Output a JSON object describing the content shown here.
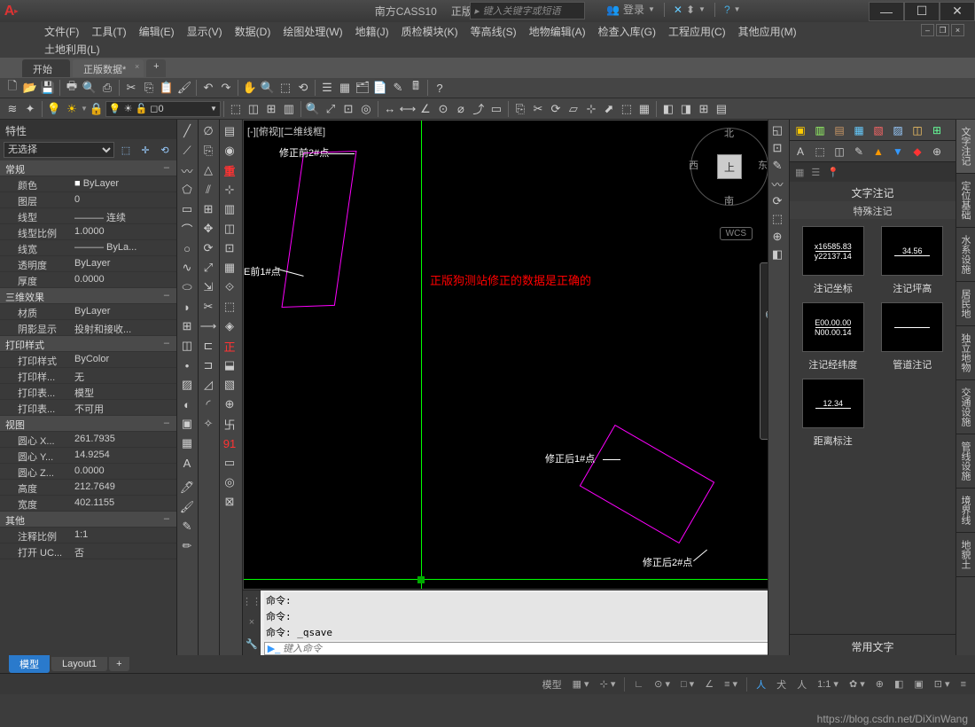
{
  "title": {
    "app": "南方CASS10",
    "file": "正版数据.dwg"
  },
  "top_search_placeholder": "键入关键字或短语",
  "login_label": "登录",
  "menus": [
    "文件(F)",
    "工具(T)",
    "编辑(E)",
    "显示(V)",
    "数据(D)",
    "绘图处理(W)",
    "地籍(J)",
    "质检模块(K)",
    "等高线(S)",
    "地物编辑(A)",
    "检查入库(G)",
    "工程应用(C)",
    "其他应用(M)"
  ],
  "menus2": [
    "土地利用(L)"
  ],
  "file_tabs": {
    "items": [
      "开始",
      "正版数据*"
    ],
    "active": 1
  },
  "layer_current": "0",
  "properties": {
    "title": "特性",
    "selection": "无选择",
    "sections": [
      {
        "name": "常规",
        "rows": [
          {
            "k": "颜色",
            "v": "ByLayer",
            "sq": true
          },
          {
            "k": "图层",
            "v": "0"
          },
          {
            "k": "线型",
            "v": "——— 连续"
          },
          {
            "k": "线型比例",
            "v": "1.0000"
          },
          {
            "k": "线宽",
            "v": "——— ByLa..."
          },
          {
            "k": "透明度",
            "v": "ByLayer"
          },
          {
            "k": "厚度",
            "v": "0.0000"
          }
        ]
      },
      {
        "name": "三维效果",
        "rows": [
          {
            "k": "材质",
            "v": "ByLayer"
          },
          {
            "k": "阴影显示",
            "v": "投射和接收..."
          }
        ]
      },
      {
        "name": "打印样式",
        "rows": [
          {
            "k": "打印样式",
            "v": "ByColor"
          },
          {
            "k": "打印样...",
            "v": "无"
          },
          {
            "k": "打印表...",
            "v": "模型"
          },
          {
            "k": "打印表...",
            "v": "不可用"
          }
        ]
      },
      {
        "name": "视图",
        "rows": [
          {
            "k": "圆心 X...",
            "v": "261.7935"
          },
          {
            "k": "圆心 Y...",
            "v": "14.9254"
          },
          {
            "k": "圆心 Z...",
            "v": "0.0000"
          },
          {
            "k": "高度",
            "v": "212.7649"
          },
          {
            "k": "宽度",
            "v": "402.1155"
          }
        ]
      },
      {
        "name": "其他",
        "rows": [
          {
            "k": "注释比例",
            "v": "1:1"
          },
          {
            "k": "打开 UC...",
            "v": "否"
          }
        ]
      }
    ]
  },
  "canvas": {
    "viewport_label": "[-][俯视][二维线框]",
    "red_text": "正版狗测站修正的数据是正确的",
    "labels": {
      "l1": "修正前2#点",
      "l2": "E前1#点",
      "l3": "修正后1#点",
      "l4": "修正后2#点"
    },
    "compass": {
      "n": "北",
      "s": "南",
      "e": "东",
      "w": "西",
      "top": "上"
    },
    "wcs": "WCS"
  },
  "command": {
    "history": [
      "命令:",
      "命令:",
      "命令:  _qsave"
    ],
    "prompt_placeholder": "键入命令"
  },
  "palette": {
    "title": "文字注记",
    "subtitle": "特殊注记",
    "items": [
      {
        "cap": "注记坐标",
        "t1": "x16585.83",
        "t2": "y22137.14"
      },
      {
        "cap": "注记坪高",
        "t1": "34.56",
        "t2": ""
      },
      {
        "cap": "注记经纬度",
        "t1": "E00.00.00",
        "t2": "N00.00.14"
      },
      {
        "cap": "管道注记",
        "t1": "",
        "t2": ""
      },
      {
        "cap": "距离标注",
        "t1": "12.34",
        "t2": ""
      }
    ],
    "footer": "常用文字",
    "side_tabs": [
      "文字注记",
      "定位基础",
      "水系设施",
      "居民地",
      "独立地物",
      "交通设施",
      "管线设施",
      "境界线",
      "地貌土"
    ]
  },
  "bottom_tabs": {
    "items": [
      "模型",
      "Layout1"
    ],
    "active": 0
  },
  "status": {
    "model": "模型",
    "grid": "▦",
    "ortho": "∟",
    "polar": "⊙",
    "osnap": "□",
    "dyn": "∠",
    "lw": "≡",
    "scale": "1:1 ▾",
    "人": "人",
    "watermark": "https://blog.csdn.net/DiXinWang"
  }
}
